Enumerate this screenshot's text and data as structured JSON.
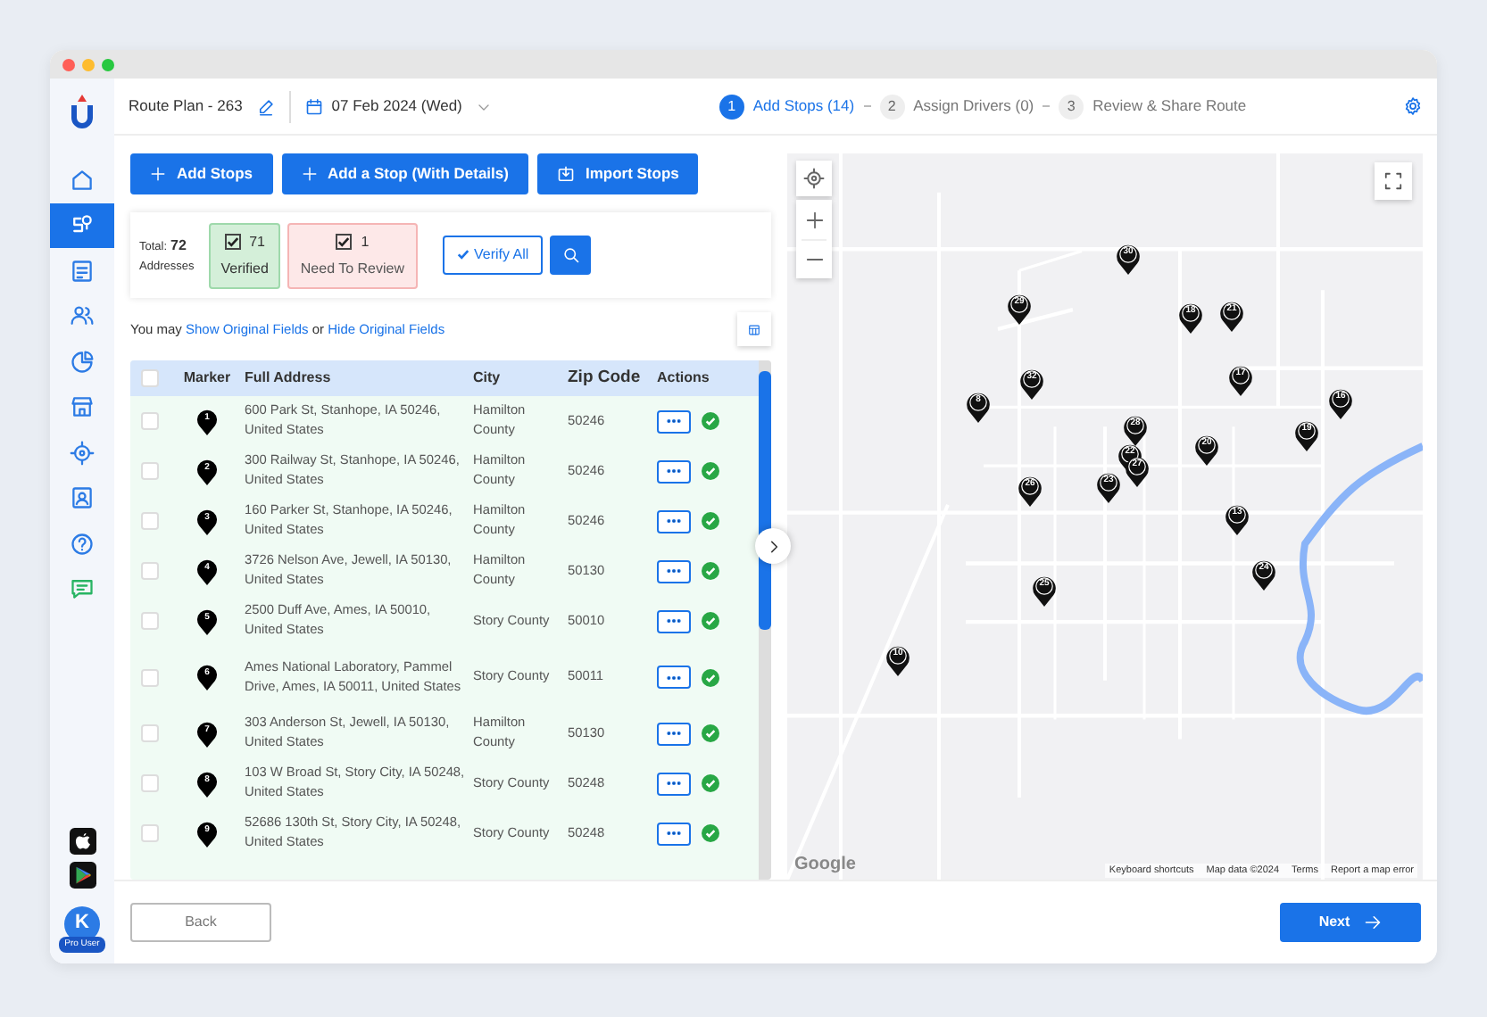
{
  "sidebar": {
    "items": [
      {
        "kind": "home",
        "selected": false
      },
      {
        "kind": "route",
        "selected": true
      },
      {
        "kind": "document",
        "selected": false
      },
      {
        "kind": "users",
        "selected": false
      },
      {
        "kind": "chart",
        "selected": false
      },
      {
        "kind": "store",
        "selected": false
      },
      {
        "kind": "target",
        "selected": false
      },
      {
        "kind": "contact",
        "selected": false
      },
      {
        "kind": "help",
        "selected": false
      },
      {
        "kind": "chat",
        "selected": false
      }
    ],
    "stores": [
      {
        "kind": "apple"
      },
      {
        "kind": "play"
      }
    ],
    "avatar": {
      "initial": "K",
      "badge": "Pro User"
    }
  },
  "header": {
    "plan_name": "Route Plan - 263",
    "date": "07 Feb 2024 (Wed)",
    "steps": [
      {
        "number": "1",
        "label": "Add Stops (14)",
        "selected": true
      },
      {
        "number": "2",
        "label": "Assign Drivers (0)",
        "selected": false
      },
      {
        "number": "3",
        "label": "Review & Share Route",
        "selected": false
      }
    ]
  },
  "actions": [
    {
      "kind": "plus",
      "label": "Add Stops"
    },
    {
      "kind": "plus",
      "label": "Add a Stop (With Details)"
    },
    {
      "kind": "import",
      "label": "Import Stops"
    }
  ],
  "summary": {
    "total_label": "Total:",
    "total": "72",
    "total_caption": "Addresses",
    "verified": {
      "count": "71",
      "label": "Verified",
      "checked": true
    },
    "review": {
      "count": "1",
      "label": "Need To Review",
      "checked": true
    },
    "verify_all": "Verify All"
  },
  "fields_note": {
    "prefix": "You may",
    "show": "Show Original Fields",
    "middle": "or",
    "hide": "Hide Original Fields"
  },
  "table": {
    "select_all_checked": false,
    "columns": [
      "Marker",
      "Full Address",
      "City",
      "Zip Code",
      "Actions"
    ],
    "rows": [
      {
        "checked": false,
        "marker": "1",
        "address": "600 Park St, Stanhope, IA 50246, United States",
        "city": "Hamilton County",
        "zip": "50246",
        "verified": true
      },
      {
        "checked": false,
        "marker": "2",
        "address": "300 Railway St, Stanhope, IA 50246, United States",
        "city": "Hamilton County",
        "zip": "50246",
        "verified": true
      },
      {
        "checked": false,
        "marker": "3",
        "address": "160 Parker St, Stanhope, IA 50246, United States",
        "city": "Hamilton County",
        "zip": "50246",
        "verified": true
      },
      {
        "checked": false,
        "marker": "4",
        "address": "3726 Nelson Ave, Jewell, IA 50130, United States",
        "city": "Hamilton County",
        "zip": "50130",
        "verified": true
      },
      {
        "checked": false,
        "marker": "5",
        "address": "2500 Duff Ave, Ames, IA 50010, United States",
        "city": "Story County",
        "zip": "50010",
        "verified": true
      },
      {
        "checked": false,
        "marker": "6",
        "address": "Ames National Laboratory, Pammel Drive, Ames, IA 50011, United States",
        "city": "Story County",
        "zip": "50011",
        "verified": true
      },
      {
        "checked": false,
        "marker": "7",
        "address": "303 Anderson St, Jewell, IA 50130, United States",
        "city": "Hamilton County",
        "zip": "50130",
        "verified": true
      },
      {
        "checked": false,
        "marker": "8",
        "address": "103 W Broad St, Story City, IA 50248, United States",
        "city": "Story County",
        "zip": "50248",
        "verified": true
      },
      {
        "checked": false,
        "marker": "9",
        "address": "52686 130th St, Story City, IA 50248, United States",
        "city": "Story County",
        "zip": "50248",
        "verified": true
      }
    ]
  },
  "map": {
    "markers": [
      "30",
      "29",
      "18",
      "21",
      "32",
      "17",
      "8",
      "16",
      "28",
      "19",
      "20",
      "22",
      "27",
      "23",
      "26",
      "13",
      "25",
      "24",
      "10"
    ],
    "logo": "Google",
    "attribution": [
      "Keyboard shortcuts",
      "Map data ©2024",
      "Terms",
      "Report a map error"
    ]
  },
  "footer": {
    "back": "Back",
    "next": "Next"
  }
}
